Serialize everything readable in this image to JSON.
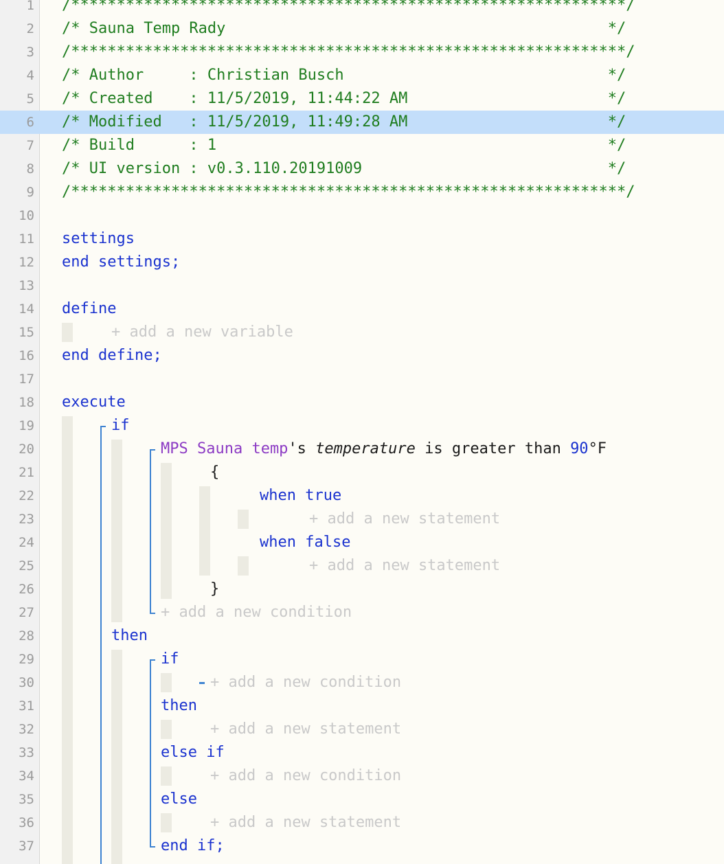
{
  "editor": {
    "lines": [
      {
        "n": "1",
        "segs": [
          {
            "t": "/*************************************************************/",
            "c": "comment"
          }
        ]
      },
      {
        "n": "2",
        "segs": [
          {
            "t": "/* Sauna Temp Rady                                          */",
            "c": "comment"
          }
        ]
      },
      {
        "n": "3",
        "segs": [
          {
            "t": "/*************************************************************/",
            "c": "comment"
          }
        ]
      },
      {
        "n": "4",
        "segs": [
          {
            "t": "/* Author     : Christian Busch                             */",
            "c": "comment"
          }
        ]
      },
      {
        "n": "5",
        "segs": [
          {
            "t": "/* Created    : 11/5/2019, 11:44:22 AM                      */",
            "c": "comment"
          }
        ]
      },
      {
        "n": "6",
        "segs": [
          {
            "t": "/* Modified   : 11/5/2019, 11:49:28 AM                      */",
            "c": "comment"
          }
        ],
        "highlight": true
      },
      {
        "n": "7",
        "segs": [
          {
            "t": "/* Build      : 1                                           */",
            "c": "comment"
          }
        ]
      },
      {
        "n": "8",
        "segs": [
          {
            "t": "/* UI version : v0.3.110.20191009                           */",
            "c": "comment"
          }
        ]
      },
      {
        "n": "9",
        "segs": [
          {
            "t": "/*************************************************************/",
            "c": "comment"
          }
        ]
      },
      {
        "n": "10",
        "segs": []
      },
      {
        "n": "11",
        "segs": [
          {
            "t": "settings",
            "c": "kw"
          }
        ]
      },
      {
        "n": "12",
        "segs": [
          {
            "t": "end settings;",
            "c": "kw"
          }
        ]
      },
      {
        "n": "13",
        "segs": []
      },
      {
        "n": "14",
        "segs": [
          {
            "t": "define",
            "c": "kw"
          }
        ]
      },
      {
        "n": "15",
        "indent": 2,
        "segs": [
          {
            "t": "+ add a new variable",
            "c": "ph"
          }
        ]
      },
      {
        "n": "16",
        "segs": [
          {
            "t": "end define;",
            "c": "kw"
          }
        ]
      },
      {
        "n": "17",
        "segs": []
      },
      {
        "n": "18",
        "segs": [
          {
            "t": "execute",
            "c": "kw"
          }
        ]
      },
      {
        "n": "19",
        "indent": 2,
        "segs": [
          {
            "t": "if",
            "c": "kw"
          }
        ]
      },
      {
        "n": "20",
        "indent": 4,
        "segs": [
          {
            "t": "MPS Sauna temp",
            "c": "dev"
          },
          {
            "t": "'s ",
            "c": "plain"
          },
          {
            "t": "temperature",
            "c": "it"
          },
          {
            "t": " is greater than ",
            "c": "plain"
          },
          {
            "t": "90",
            "c": "num"
          },
          {
            "t": "°F",
            "c": "plain"
          }
        ]
      },
      {
        "n": "21",
        "indent": 6,
        "segs": [
          {
            "t": "{",
            "c": "plain"
          }
        ]
      },
      {
        "n": "22",
        "indent": 8,
        "segs": [
          {
            "t": "when true",
            "c": "kw"
          }
        ]
      },
      {
        "n": "23",
        "indent": 10,
        "segs": [
          {
            "t": "+ add a new statement",
            "c": "ph"
          }
        ]
      },
      {
        "n": "24",
        "indent": 8,
        "segs": [
          {
            "t": "when false",
            "c": "kw"
          }
        ]
      },
      {
        "n": "25",
        "indent": 10,
        "segs": [
          {
            "t": "+ add a new statement",
            "c": "ph"
          }
        ]
      },
      {
        "n": "26",
        "indent": 6,
        "segs": [
          {
            "t": "}",
            "c": "plain"
          }
        ]
      },
      {
        "n": "27",
        "indent": 4,
        "segs": [
          {
            "t": "+ add a new condition",
            "c": "ph"
          }
        ]
      },
      {
        "n": "28",
        "indent": 2,
        "segs": [
          {
            "t": "then",
            "c": "kw"
          }
        ]
      },
      {
        "n": "29",
        "indent": 4,
        "segs": [
          {
            "t": "if",
            "c": "kw"
          }
        ]
      },
      {
        "n": "30",
        "indent": 6,
        "dash": true,
        "segs": [
          {
            "t": "+ add a new condition",
            "c": "ph"
          }
        ]
      },
      {
        "n": "31",
        "indent": 4,
        "segs": [
          {
            "t": "then",
            "c": "kw"
          }
        ]
      },
      {
        "n": "32",
        "indent": 6,
        "segs": [
          {
            "t": "+ add a new statement",
            "c": "ph"
          }
        ]
      },
      {
        "n": "33",
        "indent": 4,
        "segs": [
          {
            "t": "else if",
            "c": "kw"
          }
        ]
      },
      {
        "n": "34",
        "indent": 6,
        "segs": [
          {
            "t": "+ add a new condition",
            "c": "ph"
          }
        ]
      },
      {
        "n": "35",
        "indent": 4,
        "segs": [
          {
            "t": "else",
            "c": "kw"
          }
        ]
      },
      {
        "n": "36",
        "indent": 6,
        "segs": [
          {
            "t": "+ add a new statement",
            "c": "ph"
          }
        ]
      },
      {
        "n": "37",
        "indent": 4,
        "segs": [
          {
            "t": "end if;",
            "c": "kw"
          }
        ]
      }
    ]
  }
}
